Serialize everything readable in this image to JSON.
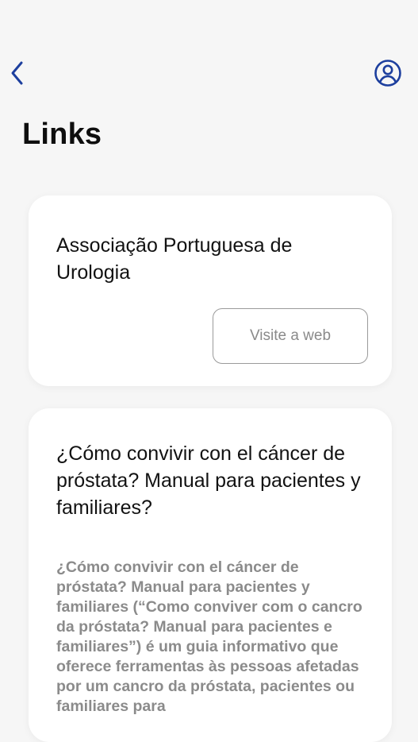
{
  "header": {
    "back_icon": "chevron-left-icon",
    "profile_icon": "user-circle-icon",
    "accent_color": "#1d3f9e"
  },
  "page": {
    "title": "Links"
  },
  "links": [
    {
      "title": "Associação Portuguesa de Urologia",
      "button_label": "Visite a web"
    },
    {
      "title": "¿Cómo convivir con el cáncer de próstata? Manual para pacientes y familiares?",
      "description": "¿Cómo convivir con el cáncer de próstata? Manual para pacientes y familiares (“Como conviver com o cancro da próstata? Manual para pacientes e familiares”) é um guia informativo que oferece ferramentas às pessoas afetadas por um cancro da próstata, pacientes ou familiares para"
    }
  ]
}
